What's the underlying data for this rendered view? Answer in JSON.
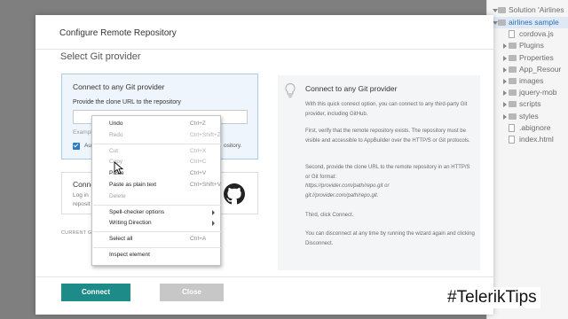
{
  "solution": {
    "root_label": "Solution 'Airlines",
    "items": [
      {
        "label": "airlines sample",
        "kind": "project",
        "expanded": true,
        "selected": true
      },
      {
        "label": "cordova.js",
        "kind": "file"
      },
      {
        "label": "Plugins",
        "kind": "folder"
      },
      {
        "label": "Properties",
        "kind": "folder"
      },
      {
        "label": "App_Resour",
        "kind": "folder"
      },
      {
        "label": "images",
        "kind": "folder"
      },
      {
        "label": "jquery-mob",
        "kind": "folder"
      },
      {
        "label": "scripts",
        "kind": "folder"
      },
      {
        "label": "styles",
        "kind": "folder"
      },
      {
        "label": ".abignore",
        "kind": "file"
      },
      {
        "label": "index.html",
        "kind": "file"
      }
    ]
  },
  "dialog": {
    "title": "Configure Remote Repository",
    "section_title": "Select Git provider",
    "any_git": {
      "title": "Connect to any Git provider",
      "url_label": "Provide the clone URL to the repository",
      "url_value": "",
      "example_text": "Exampl",
      "checkbox_checked": true,
      "checkbox_label_start": "Au",
      "checkbox_label_end": "ository."
    },
    "github": {
      "title": "Conne",
      "desc_line1": "Log in",
      "desc_line2": "reposit"
    },
    "current_label": "CURRENT GI",
    "info": {
      "title": "Connect to any Git provider",
      "p1": "With this quick connect option, you can connect to any third-party Git provider, including GitHub.",
      "p2": "First, verify that the remote repository exists. The repository must be visible and accessible to AppBuilder over the HTTP/S or Git protocols.",
      "p3_intro": "Second, provide the clone URL to the remote repository in an HTTP/S or Git format:",
      "p3_example1": "https://provider.com/path/repo.git or",
      "p3_example2": "git://provider.com/path/repo.git.",
      "p4": "Third, click Connect.",
      "p5": "You can disconnect at any time by running the wizard again and clicking Disconnect."
    },
    "buttons": {
      "connect": "Connect",
      "close": "Close"
    }
  },
  "context_menu": {
    "groups": [
      [
        {
          "label": "Undo",
          "shortcut": "Ctrl+Z",
          "disabled": false
        },
        {
          "label": "Redo",
          "shortcut": "Ctrl+Shift+Z",
          "disabled": true
        }
      ],
      [
        {
          "label": "Cut",
          "shortcut": "Ctrl+X",
          "disabled": true
        },
        {
          "label": "Copy",
          "shortcut": "Ctrl+C",
          "disabled": true
        },
        {
          "label": "Paste",
          "shortcut": "Ctrl+V",
          "disabled": false
        },
        {
          "label": "Paste as plain text",
          "shortcut": "Ctrl+Shift+V",
          "disabled": false
        },
        {
          "label": "Delete",
          "shortcut": "",
          "disabled": true
        }
      ],
      [
        {
          "label": "Spell-checker options",
          "submenu": true,
          "disabled": false
        },
        {
          "label": "Writing Direction",
          "submenu": true,
          "disabled": false
        }
      ],
      [
        {
          "label": "Select all",
          "shortcut": "Ctrl+A",
          "disabled": false
        }
      ],
      [
        {
          "label": "Inspect element",
          "shortcut": "",
          "disabled": false
        }
      ]
    ]
  },
  "overlay": {
    "hashtag": "#TelerikTips"
  },
  "colors": {
    "accent": "#1d8b88",
    "selected_card_bg": "#eef5fc",
    "selected_card_border": "#a8cbea",
    "checkbox": "#2a7cc7"
  }
}
